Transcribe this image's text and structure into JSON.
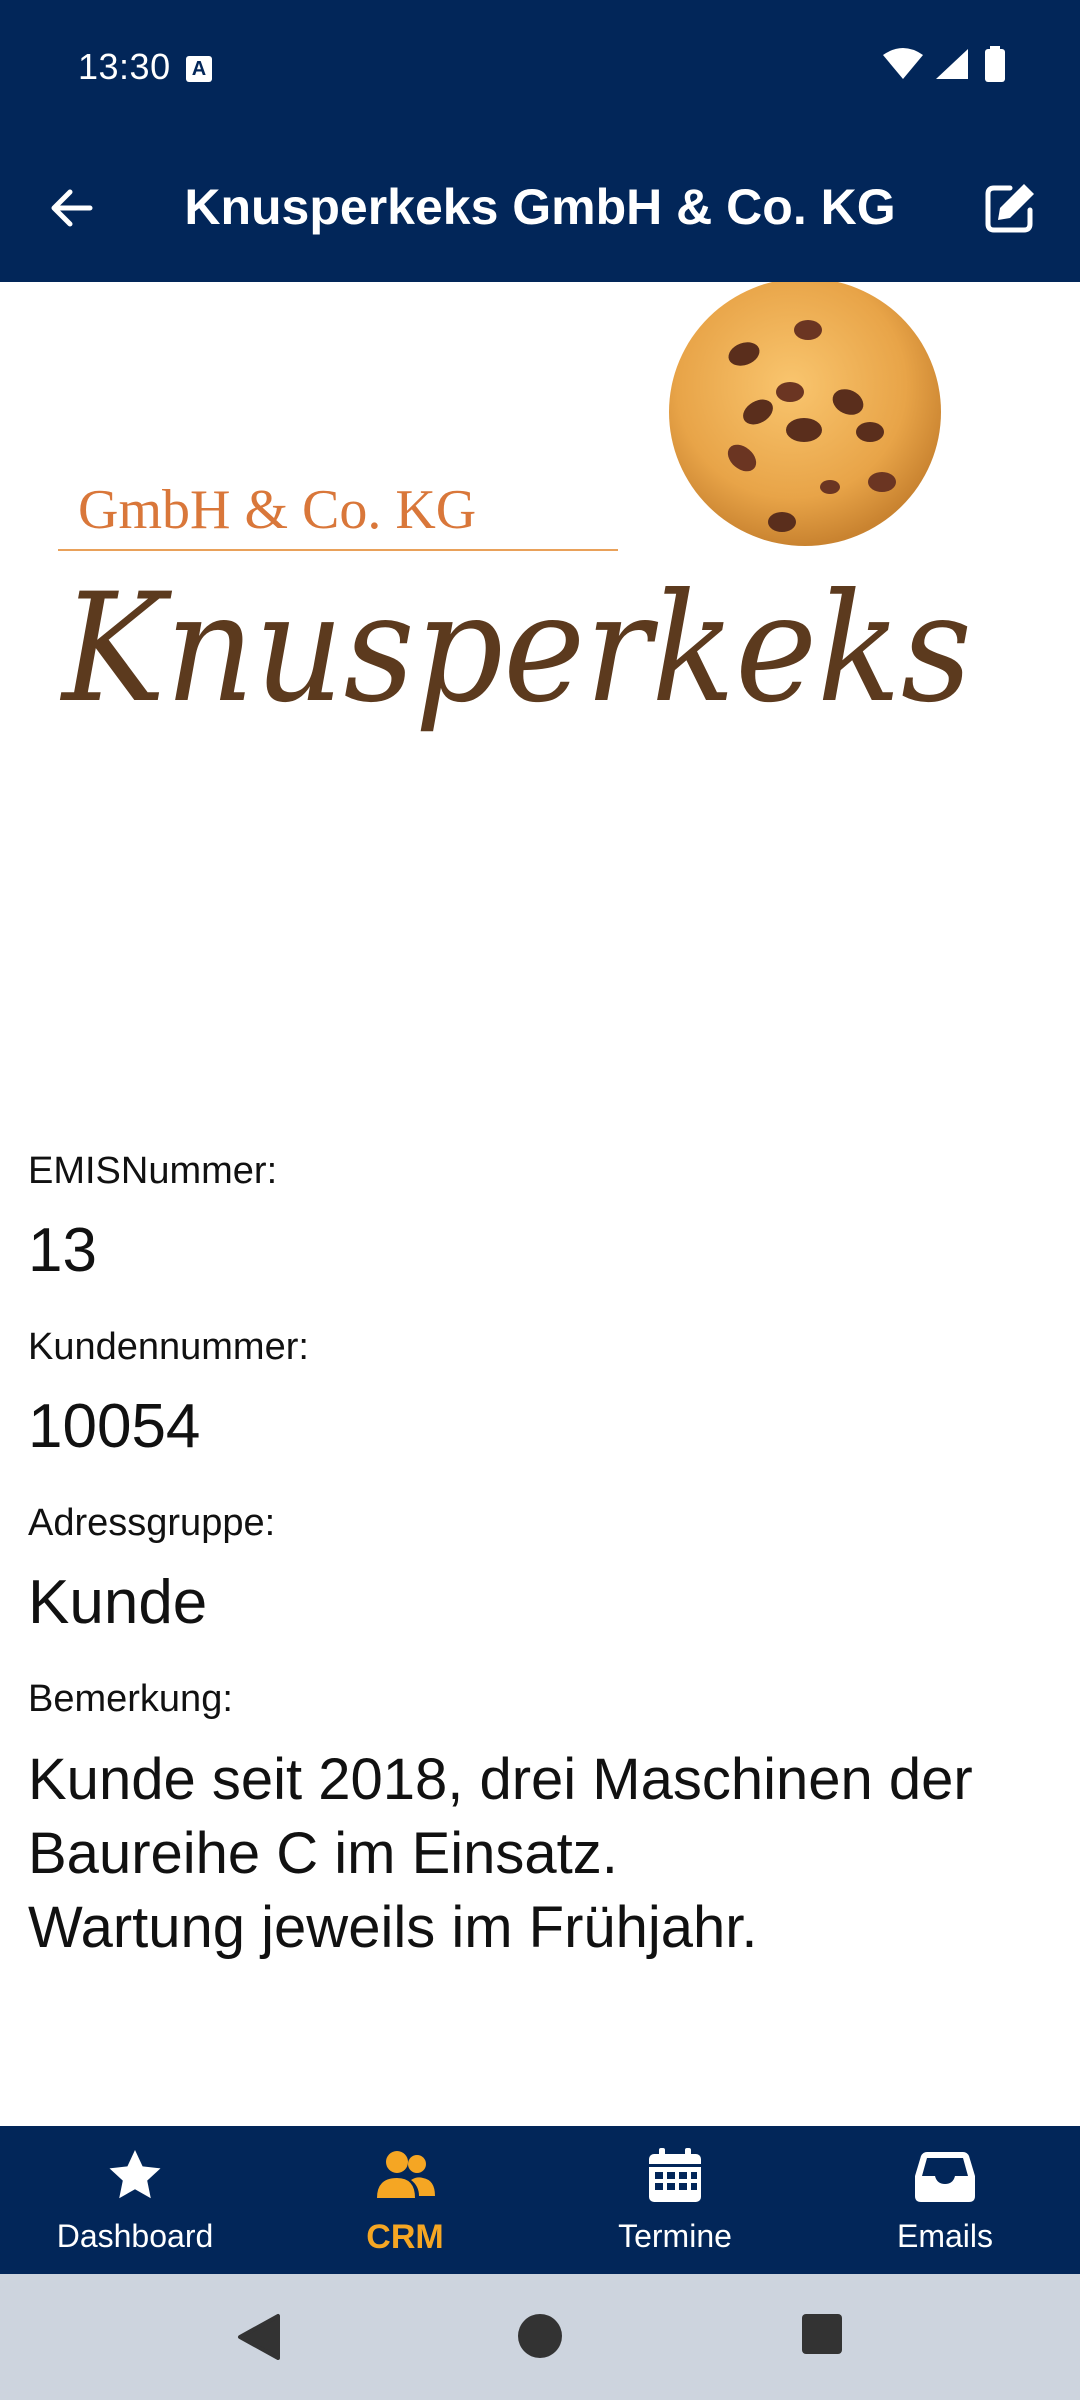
{
  "status_bar": {
    "time": "13:30",
    "badge": "A"
  },
  "app_bar": {
    "title": "Knusperkeks GmbH & Co. KG"
  },
  "logo": {
    "tagline": "GmbH & Co. KG",
    "name": "Knusperkeks"
  },
  "details": {
    "emis_label": "EMISNummer:",
    "emis_value": "13",
    "kunden_label": "Kundennummer:",
    "kunden_value": "10054",
    "adress_label": "Adressgruppe:",
    "adress_value": "Kunde",
    "bemerkung_label": "Bemerkung:",
    "bemerkung_line1": "Kunde seit 2018, drei Maschinen der",
    "bemerkung_line2": "Baureihe C im Einsatz.",
    "bemerkung_line3": "Wartung jeweils im Frühjahr."
  },
  "bottom_nav": {
    "items": [
      {
        "label": "Dashboard",
        "icon": "star-icon"
      },
      {
        "label": "CRM",
        "icon": "users-icon",
        "active": true
      },
      {
        "label": "Termine",
        "icon": "calendar-icon"
      },
      {
        "label": "Emails",
        "icon": "inbox-icon"
      }
    ]
  },
  "colors": {
    "primary": "#022659",
    "accent": "#F5A623",
    "system_nav": "#CDD4DE"
  }
}
